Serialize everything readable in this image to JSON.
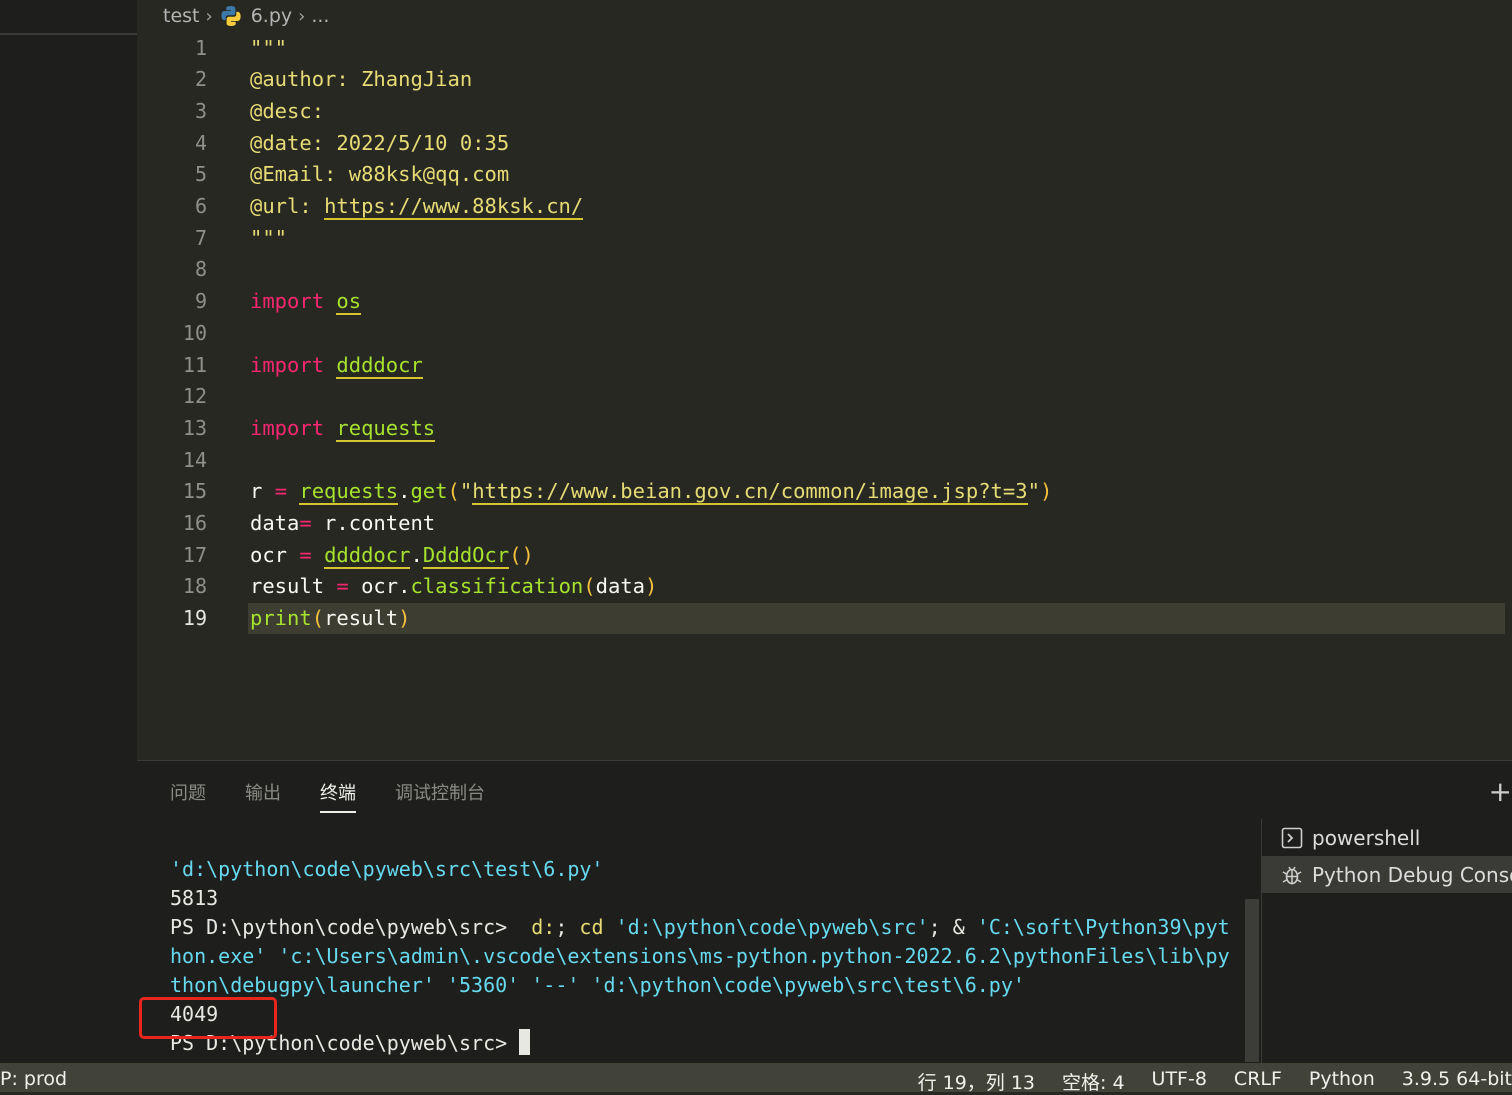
{
  "breadcrumb": {
    "folder": "test",
    "file": "6.py",
    "more": "..."
  },
  "editor": {
    "lines": [
      {
        "n": "1",
        "parts": [
          {
            "t": "\"\"\"",
            "c": "c-str"
          }
        ]
      },
      {
        "n": "2",
        "parts": [
          {
            "t": "@author: ZhangJian",
            "c": "c-str"
          }
        ]
      },
      {
        "n": "3",
        "parts": [
          {
            "t": "@desc:",
            "c": "c-str"
          }
        ]
      },
      {
        "n": "4",
        "parts": [
          {
            "t": "@date: 2022/5/10 0:35",
            "c": "c-str"
          }
        ]
      },
      {
        "n": "5",
        "parts": [
          {
            "t": "@Email: w88ksk@qq.com",
            "c": "c-str"
          }
        ]
      },
      {
        "n": "6",
        "parts": [
          {
            "t": "@url: ",
            "c": "c-str"
          },
          {
            "t": "https://www.88ksk.cn/",
            "c": "c-url"
          }
        ]
      },
      {
        "n": "7",
        "parts": [
          {
            "t": "\"\"\"",
            "c": "c-str"
          }
        ]
      },
      {
        "n": "8",
        "parts": []
      },
      {
        "n": "9",
        "parts": [
          {
            "t": "import",
            "c": "c-kw"
          },
          {
            "t": " ",
            "c": ""
          },
          {
            "t": "os",
            "c": "c-mod"
          }
        ]
      },
      {
        "n": "10",
        "parts": []
      },
      {
        "n": "11",
        "parts": [
          {
            "t": "import",
            "c": "c-kw"
          },
          {
            "t": " ",
            "c": ""
          },
          {
            "t": "ddddocr",
            "c": "c-mod"
          }
        ]
      },
      {
        "n": "12",
        "parts": []
      },
      {
        "n": "13",
        "parts": [
          {
            "t": "import",
            "c": "c-kw"
          },
          {
            "t": " ",
            "c": ""
          },
          {
            "t": "requests",
            "c": "c-mod"
          }
        ]
      },
      {
        "n": "14",
        "parts": []
      },
      {
        "n": "15",
        "parts": [
          {
            "t": "r ",
            "c": ""
          },
          {
            "t": "=",
            "c": "c-op"
          },
          {
            "t": " ",
            "c": ""
          },
          {
            "t": "requests",
            "c": "c-mod"
          },
          {
            "t": ".",
            "c": ""
          },
          {
            "t": "get",
            "c": "c-fn"
          },
          {
            "t": "(",
            "c": "c-par"
          },
          {
            "t": "\"",
            "c": "c-str"
          },
          {
            "t": "https://www.beian.gov.cn/common/image.jsp?t=3",
            "c": "c-url"
          },
          {
            "t": "\"",
            "c": "c-str"
          },
          {
            "t": ")",
            "c": "c-par"
          }
        ]
      },
      {
        "n": "16",
        "parts": [
          {
            "t": "data",
            "c": ""
          },
          {
            "t": "=",
            "c": "c-op"
          },
          {
            "t": " r.content",
            "c": ""
          }
        ]
      },
      {
        "n": "17",
        "parts": [
          {
            "t": "ocr ",
            "c": ""
          },
          {
            "t": "=",
            "c": "c-op"
          },
          {
            "t": " ",
            "c": ""
          },
          {
            "t": "ddddocr",
            "c": "c-mod"
          },
          {
            "t": ".",
            "c": ""
          },
          {
            "t": "DdddOcr",
            "c": "c-mod"
          },
          {
            "t": "()",
            "c": "c-par"
          }
        ]
      },
      {
        "n": "18",
        "parts": [
          {
            "t": "result ",
            "c": ""
          },
          {
            "t": "=",
            "c": "c-op"
          },
          {
            "t": " ocr.",
            "c": ""
          },
          {
            "t": "classification",
            "c": "c-fn"
          },
          {
            "t": "(",
            "c": "c-par"
          },
          {
            "t": "data",
            "c": ""
          },
          {
            "t": ")",
            "c": "c-par"
          }
        ]
      },
      {
        "n": "19",
        "parts": [
          {
            "t": "print",
            "c": "c-fn"
          },
          {
            "t": "(",
            "c": "c-par"
          },
          {
            "t": "result",
            "c": ""
          },
          {
            "t": ")",
            "c": "c-par"
          }
        ],
        "active": true
      }
    ]
  },
  "panel": {
    "tabs": [
      "问题",
      "输出",
      "终端",
      "调试控制台"
    ],
    "active_tab": 2,
    "plus": "+",
    "terminal_lines": [
      [
        {
          "t": "'d:\\python\\code\\pyweb\\src\\test\\6.py'",
          "c": "t-str"
        }
      ],
      [
        {
          "t": "5813",
          "c": ""
        }
      ],
      [
        {
          "t": "PS D:\\python\\code\\pyweb\\src>  ",
          "c": ""
        },
        {
          "t": "d:",
          "c": "t-cmd"
        },
        {
          "t": "; ",
          "c": ""
        },
        {
          "t": "cd",
          "c": "t-cmd"
        },
        {
          "t": " ",
          "c": ""
        },
        {
          "t": "'d:\\python\\code\\pyweb\\src'",
          "c": "t-str"
        },
        {
          "t": "; & ",
          "c": ""
        },
        {
          "t": "'C:\\soft\\Python39\\pyt",
          "c": "t-str"
        }
      ],
      [
        {
          "t": "hon.exe' 'c:\\Users\\admin\\.vscode\\extensions\\ms-python.python-2022.6.2\\pythonFiles\\lib\\py",
          "c": "t-str"
        }
      ],
      [
        {
          "t": "thon\\debugpy\\launcher' '5360' '--' 'd:\\python\\code\\pyweb\\src\\test\\6.py'",
          "c": "t-str"
        }
      ],
      [
        {
          "t": "4049",
          "c": ""
        }
      ],
      [
        {
          "t": "PS D:\\python\\code\\pyweb\\src> ",
          "c": ""
        }
      ]
    ],
    "terminals": [
      {
        "label": "powershell",
        "icon": "terminal-icon"
      },
      {
        "label": "Python Debug Console",
        "icon": "debug-icon"
      }
    ]
  },
  "status": {
    "left": "P: prod",
    "position": "行 19，列 13",
    "spaces": "空格: 4",
    "encoding": "UTF-8",
    "eol": "CRLF",
    "language": "Python",
    "interpreter": "3.9.5 64-bit"
  }
}
